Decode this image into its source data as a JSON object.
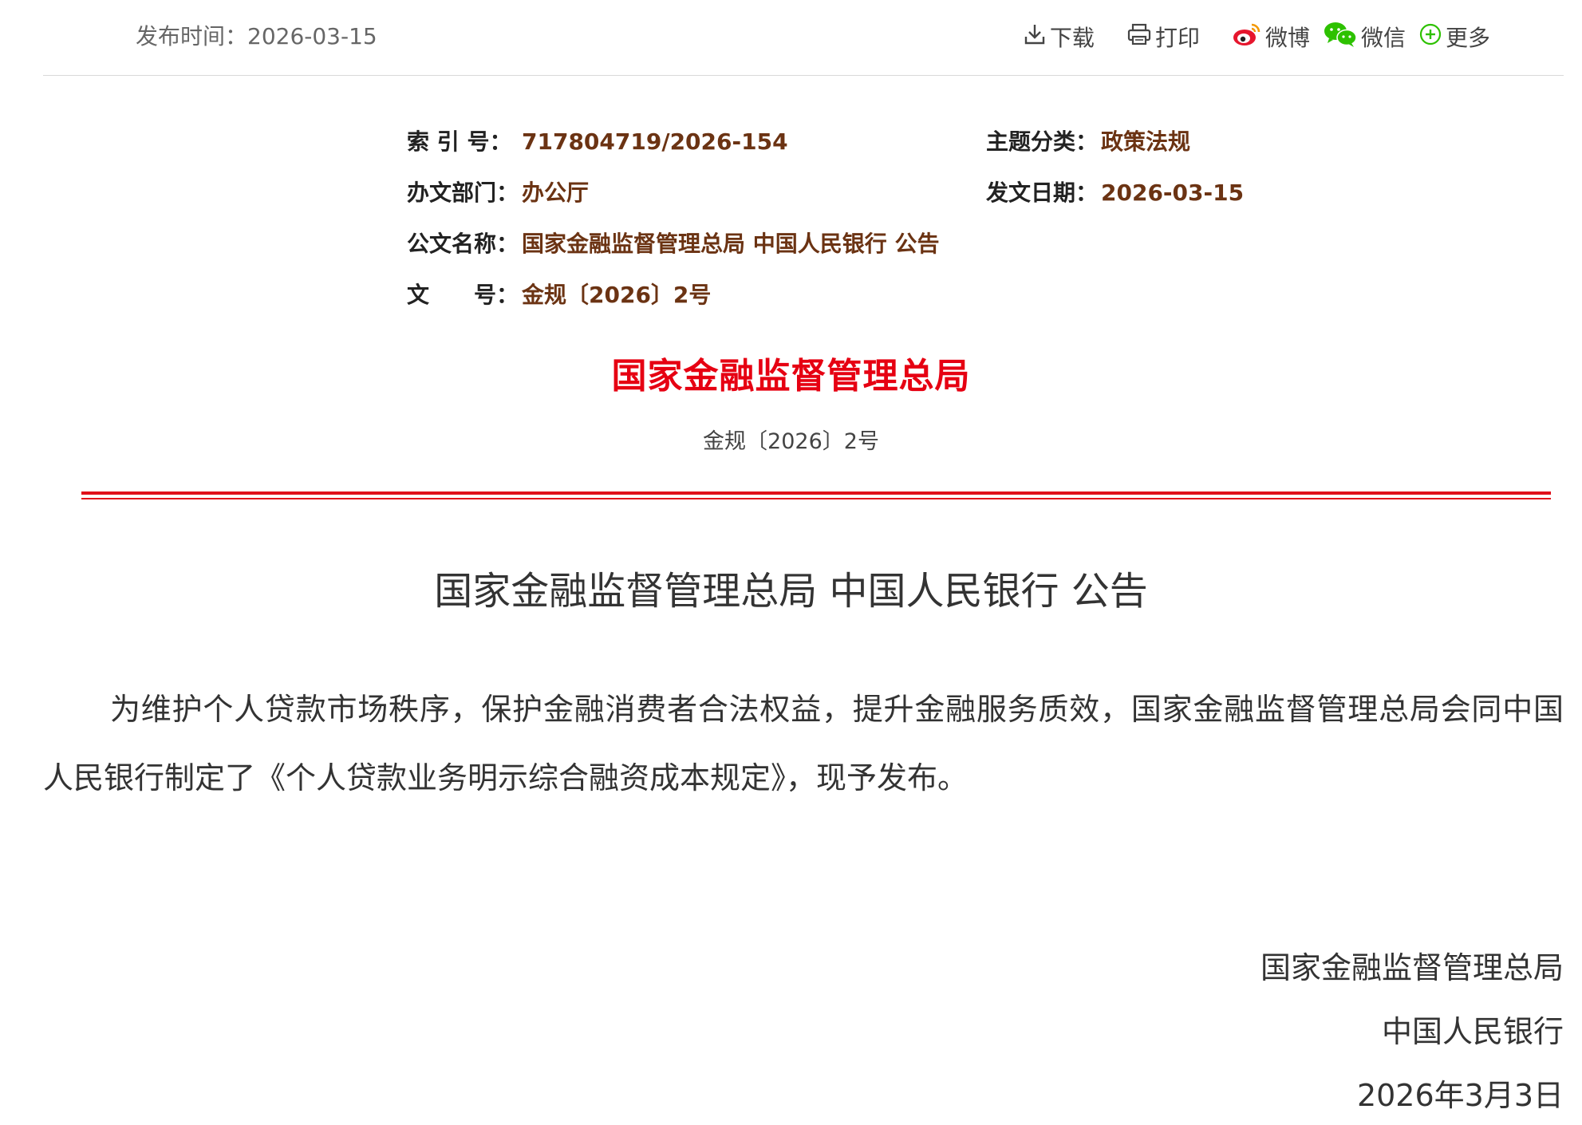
{
  "header": {
    "publish_time": "发布时间：2026-03-15",
    "tools": {
      "download": "下载",
      "print": "打印",
      "weibo": "微博",
      "wechat": "微信",
      "more": "更多"
    }
  },
  "meta": {
    "index_label": "索 引 号：",
    "index_value": "717804719/2026-154",
    "topic_label": "主题分类：",
    "topic_value": "政策法规",
    "dept_label": "办文部门：",
    "dept_value": "办公厅",
    "date_label": "发文日期：",
    "date_value": "2026-03-15",
    "name_label": "公文名称：",
    "name_value": "国家金融监督管理总局 中国人民银行 公告",
    "number_label": "文　　号：",
    "number_value": "金规〔2026〕2号"
  },
  "letterhead": {
    "org": "国家金融监督管理总局",
    "doc_no": "金规〔2026〕2号"
  },
  "body": {
    "title": "国家金融监督管理总局 中国人民银行 公告",
    "paragraph": "为维护个人贷款市场秩序，保护金融消费者合法权益，提升金融服务质效，国家金融监督管理总局会同中国人民银行制定了《个人贷款业务明示综合融资成本规定》，现予发布。"
  },
  "signature": {
    "org1": "国家金融监督管理总局",
    "org2": "中国人民银行",
    "date": "2026年3月3日"
  },
  "colors": {
    "accent_red": "#e60012",
    "meta_value": "#6b3313"
  }
}
